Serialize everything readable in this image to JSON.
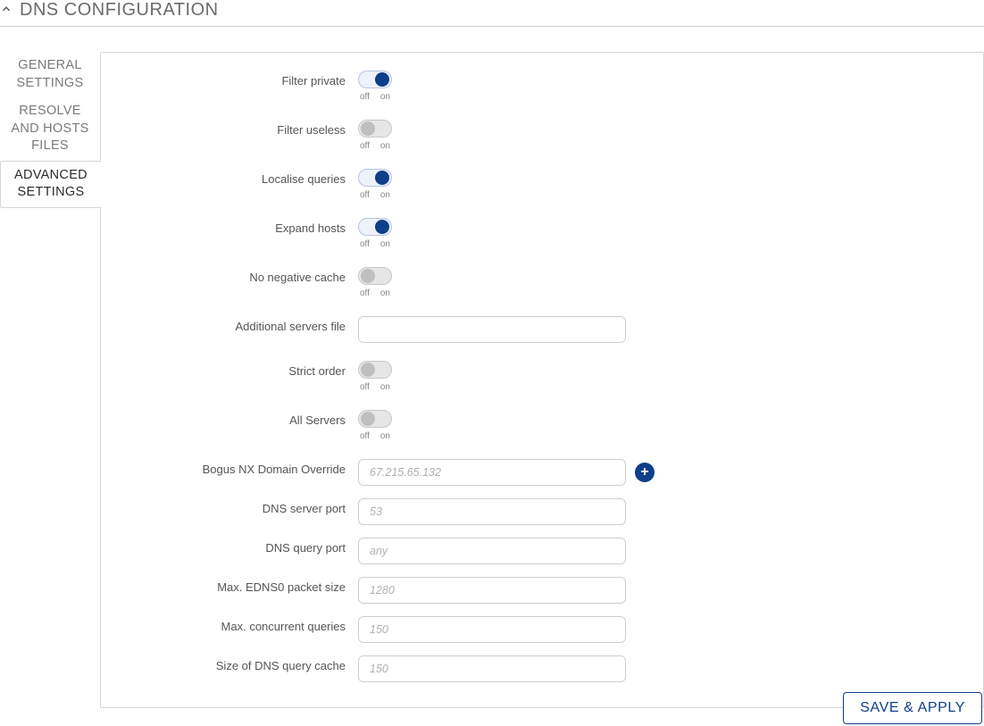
{
  "header": {
    "title": "DNS CONFIGURATION"
  },
  "tabs": [
    {
      "label": "GENERAL SETTINGS"
    },
    {
      "label": "RESOLVE AND HOSTS FILES"
    },
    {
      "label": "ADVANCED SETTINGS"
    }
  ],
  "toggle_legend": {
    "off": "off",
    "on": "on"
  },
  "fields": {
    "filter_private": {
      "label": "Filter private",
      "state": "on"
    },
    "filter_useless": {
      "label": "Filter useless",
      "state": "off"
    },
    "localise_queries": {
      "label": "Localise queries",
      "state": "on"
    },
    "expand_hosts": {
      "label": "Expand hosts",
      "state": "on"
    },
    "no_negative_cache": {
      "label": "No negative cache",
      "state": "off"
    },
    "additional_servers_file": {
      "label": "Additional servers file",
      "value": ""
    },
    "strict_order": {
      "label": "Strict order",
      "state": "off"
    },
    "all_servers": {
      "label": "All Servers",
      "state": "off"
    },
    "bogus_nx": {
      "label": "Bogus NX Domain Override",
      "placeholder": "67.215.65.132",
      "value": ""
    },
    "dns_server_port": {
      "label": "DNS server port",
      "placeholder": "53",
      "value": ""
    },
    "dns_query_port": {
      "label": "DNS query port",
      "placeholder": "any",
      "value": ""
    },
    "max_edns0": {
      "label": "Max. EDNS0 packet size",
      "placeholder": "1280",
      "value": ""
    },
    "max_concurrent": {
      "label": "Max. concurrent queries",
      "placeholder": "150",
      "value": ""
    },
    "cache_size": {
      "label": "Size of DNS query cache",
      "placeholder": "150",
      "value": ""
    }
  },
  "buttons": {
    "save_apply": "SAVE & APPLY"
  }
}
